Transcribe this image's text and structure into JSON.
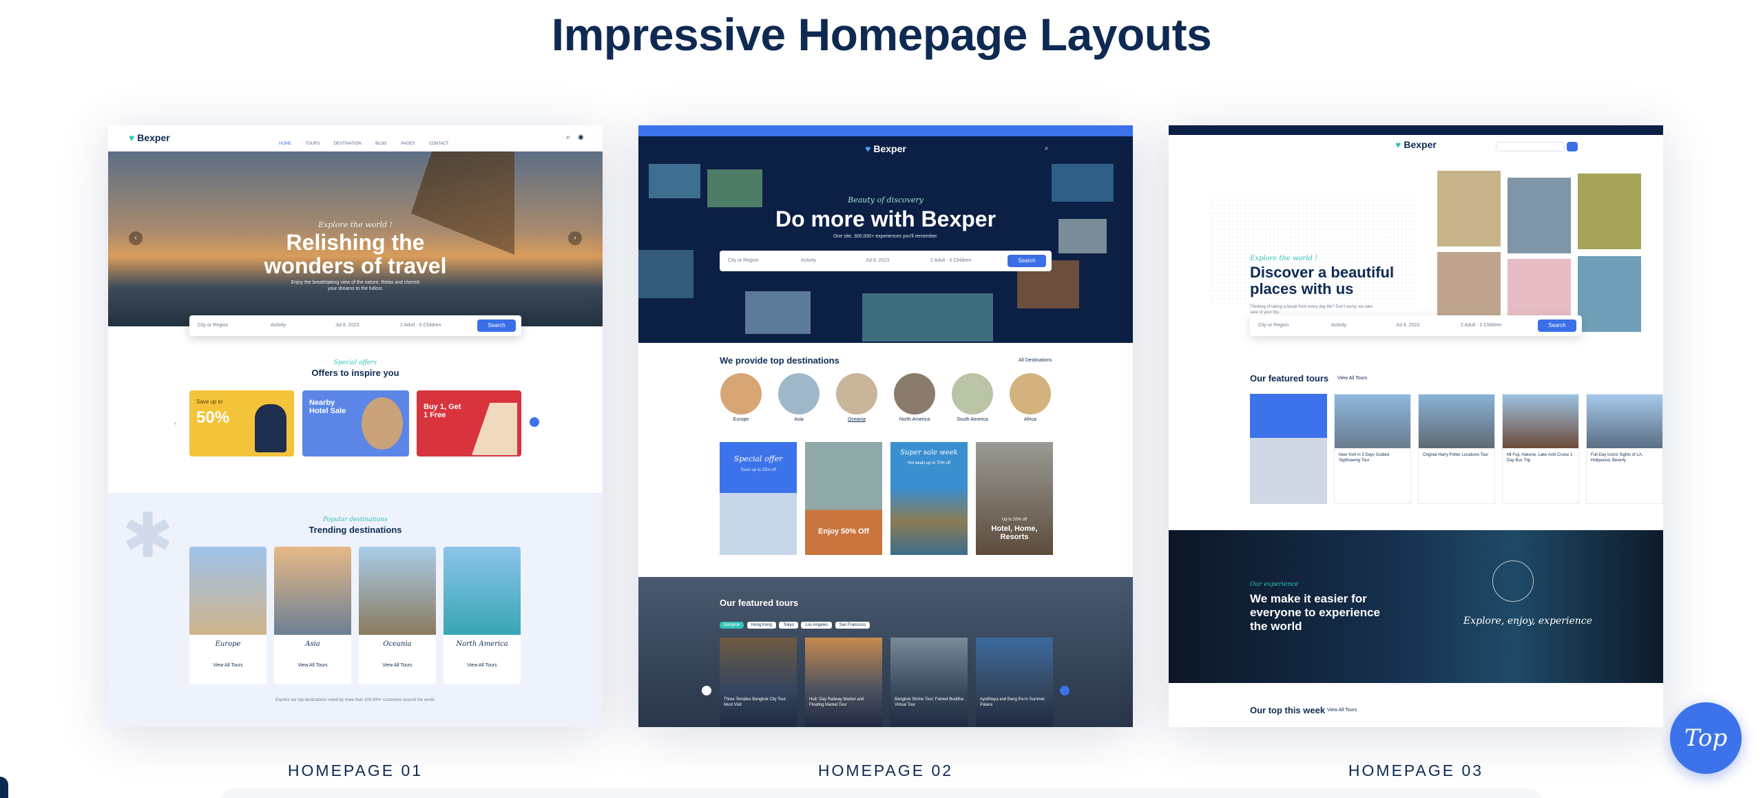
{
  "page": {
    "title": "Impressive Homepage Layouts",
    "top_button": "Top"
  },
  "colors": {
    "navy": "#0f2a52",
    "accent": "#3d73ea",
    "teal": "#33c2b6"
  },
  "cards": [
    {
      "label": "HOMEPAGE 01",
      "logo": "Bexper",
      "nav": [
        "HOME",
        "TOURS",
        "DESTINATION",
        "BLOG",
        "PAGES",
        "CONTACT"
      ],
      "hero_script": "Explore the world !",
      "hero_title_1": "Relishing the",
      "hero_title_2": "wonders of travel",
      "hero_sub": "Enjoy the breathtaking view of the nature. Relax and cherish your dreams to the fullest.",
      "search": {
        "location": "City or Region",
        "activity": "Activity",
        "date": "Jul 8, 2023",
        "guests": "2 Adult · 0 Children",
        "button": "Search"
      },
      "offers_script": "Special offers",
      "offers_title": "Offers to inspire you",
      "offers": [
        {
          "title": "Save up to",
          "big": "50%"
        },
        {
          "title": "Nearby Hotel Sale"
        },
        {
          "title": "Buy 1, Get 1 Free"
        }
      ],
      "trend_script": "Popular destinations",
      "trend_title": "Trending destinations",
      "destinations": [
        "Europe",
        "Asia",
        "Oceania",
        "North America"
      ],
      "view_all": "View All Tours",
      "footnote": "Explore our top destinations voted by more than 100,000+ customers around the world."
    },
    {
      "label": "HOMEPAGE 02",
      "logo": "Bexper",
      "hero_script": "Beauty of discovery",
      "hero_title": "Do more with Bexper",
      "hero_sub": "One site, 300,000+ experiences you'll remember.",
      "search": {
        "location": "City or Region",
        "activity": "Activity",
        "date": "Jul 8, 2023",
        "guests": "2 Adult · 0 Children",
        "button": "Search"
      },
      "dest_title": "We provide top destinations",
      "dest_link": "All Destinations",
      "regions": [
        "Europe",
        "Asia",
        "Oceania",
        "North America",
        "South America",
        "Africa"
      ],
      "promos": [
        {
          "script": "Special offer",
          "sub": "Tours up to 25% off"
        },
        {
          "title": "Enjoy 50% Off"
        },
        {
          "script": "Super sale week",
          "sub": "Hot deals up to 70% off"
        },
        {
          "title": "Hotel, Home, Resorts",
          "sub": "Up to 20% off"
        }
      ],
      "featured_title": "Our featured tours",
      "tabs": [
        "Bangkok",
        "Hong Kong",
        "Tokyo",
        "Los Angeles",
        "San Francisco"
      ],
      "tours": [
        "Three Temples Bangkok City Tour: Must Visit",
        "Huệ: Day Railway Market and Floating Market Tour",
        "Bangkok Shrine Tour: Famed Buddha Virtual Tour",
        "Ayutthaya and Bang Pa-In Summer Palace"
      ]
    },
    {
      "label": "HOMEPAGE 03",
      "logo": "Bexper",
      "hero_script": "Explore the world !",
      "hero_title_1": "Discover a beautiful",
      "hero_title_2": "places with us",
      "hero_sub": "Thinking of taking a break from every day life? Don't worry, we take care of your trip.",
      "search": {
        "location": "City or Region",
        "activity": "Activity",
        "date": "Jul 8, 2023",
        "guests": "2 Adult · 0 Children",
        "button": "Search"
      },
      "featured_title": "Our featured tours",
      "featured_link": "View All Tours",
      "tours": [
        "New York in 3 Days Guided Sightseeing Tour",
        "Original Harry Potter Locations Tour",
        "Mt Fuji, Hakone, Lake Ashi Cruise 1 Day Bus Trip",
        "Full-Day Iconic Sights of LA, Hollywood, Beverly"
      ],
      "banner_script": "Our experience",
      "banner_title_1": "We make it easier for",
      "banner_title_2": "everyone to experience",
      "banner_title_3": "the world",
      "banner_right": "Explore, enjoy, experience",
      "week_title": "Our top this week",
      "week_link": "View All Tours"
    }
  ]
}
